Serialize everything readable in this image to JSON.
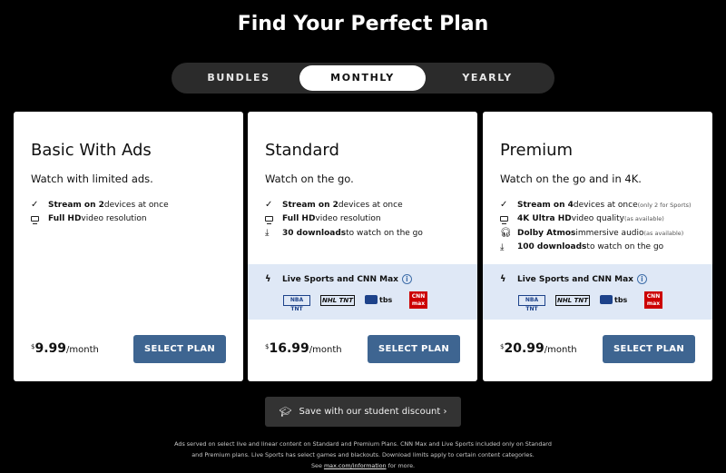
{
  "title": "Find Your Perfect Plan",
  "tabs": [
    "BUNDLES",
    "MONTHLY",
    "YEARLY"
  ],
  "selected_tab": "MONTHLY",
  "plans": [
    {
      "name": "Basic With Ads",
      "desc": "Watch with limited ads.",
      "features": [
        {
          "icon": "check-icon",
          "bold": "Stream on 2",
          "rest": " devices at once",
          "note": ""
        },
        {
          "icon": "tv-icon",
          "bold": "Full HD",
          "rest": " video resolution",
          "note": ""
        }
      ],
      "price_symbol": "$",
      "price_amount": "9.99",
      "price_period": "/month",
      "cta": "SELECT PLAN"
    },
    {
      "name": "Standard",
      "desc": "Watch on the go.",
      "features": [
        {
          "icon": "check-icon",
          "bold": "Stream on 2",
          "rest": " devices at once",
          "note": ""
        },
        {
          "icon": "tv-icon",
          "bold": "Full HD",
          "rest": " video resolution",
          "note": ""
        },
        {
          "icon": "download-icon",
          "bold": "30 downloads",
          "rest": " to watch on the go",
          "note": ""
        }
      ],
      "sports_label": "Live Sports and CNN Max",
      "price_symbol": "$",
      "price_amount": "16.99",
      "price_period": "/month",
      "cta": "SELECT PLAN"
    },
    {
      "name": "Premium",
      "desc": "Watch on the go and in 4K.",
      "features": [
        {
          "icon": "check-icon",
          "bold": "Stream on 4",
          "rest": " devices at once ",
          "note": "(only 2 for Sports)"
        },
        {
          "icon": "tv-icon",
          "bold": "4K Ultra HD",
          "rest": " video quality ",
          "note": "(as available)"
        },
        {
          "icon": "headphones-icon",
          "bold": "Dolby Atmos",
          "rest": " immersive audio ",
          "note": "(as available)"
        },
        {
          "icon": "download-icon",
          "bold": "100 downloads",
          "rest": " to watch on the go",
          "note": ""
        }
      ],
      "sports_label": "Live Sports and CNN Max",
      "price_symbol": "$",
      "price_amount": "20.99",
      "price_period": "/month",
      "cta": "SELECT PLAN"
    }
  ],
  "sports_logos": {
    "nba": "NBA",
    "nba_tnt": "TNT",
    "nhl": "NHL",
    "nhl_tnt": "TNT",
    "tbs": "tbs",
    "cnn": "CNN",
    "cnn_sub": "max"
  },
  "student": {
    "label": "Save with our student discount ›",
    "icon": "graduation-cap-icon"
  },
  "fine_print": {
    "line1": "Ads served on select live and linear content on Standard and Premium Plans. CNN Max and Live Sports included only on Standard",
    "line2": "and Premium plans. Live Sports has select games and blackouts. Download limits apply to certain content categories.",
    "see": "See",
    "link": "max.com/information",
    "after": "for more."
  },
  "colors": {
    "background": "#000000",
    "button": "#3e6591",
    "sports_band": "#dfe8f6",
    "info_icon": "#3f6ea9"
  }
}
